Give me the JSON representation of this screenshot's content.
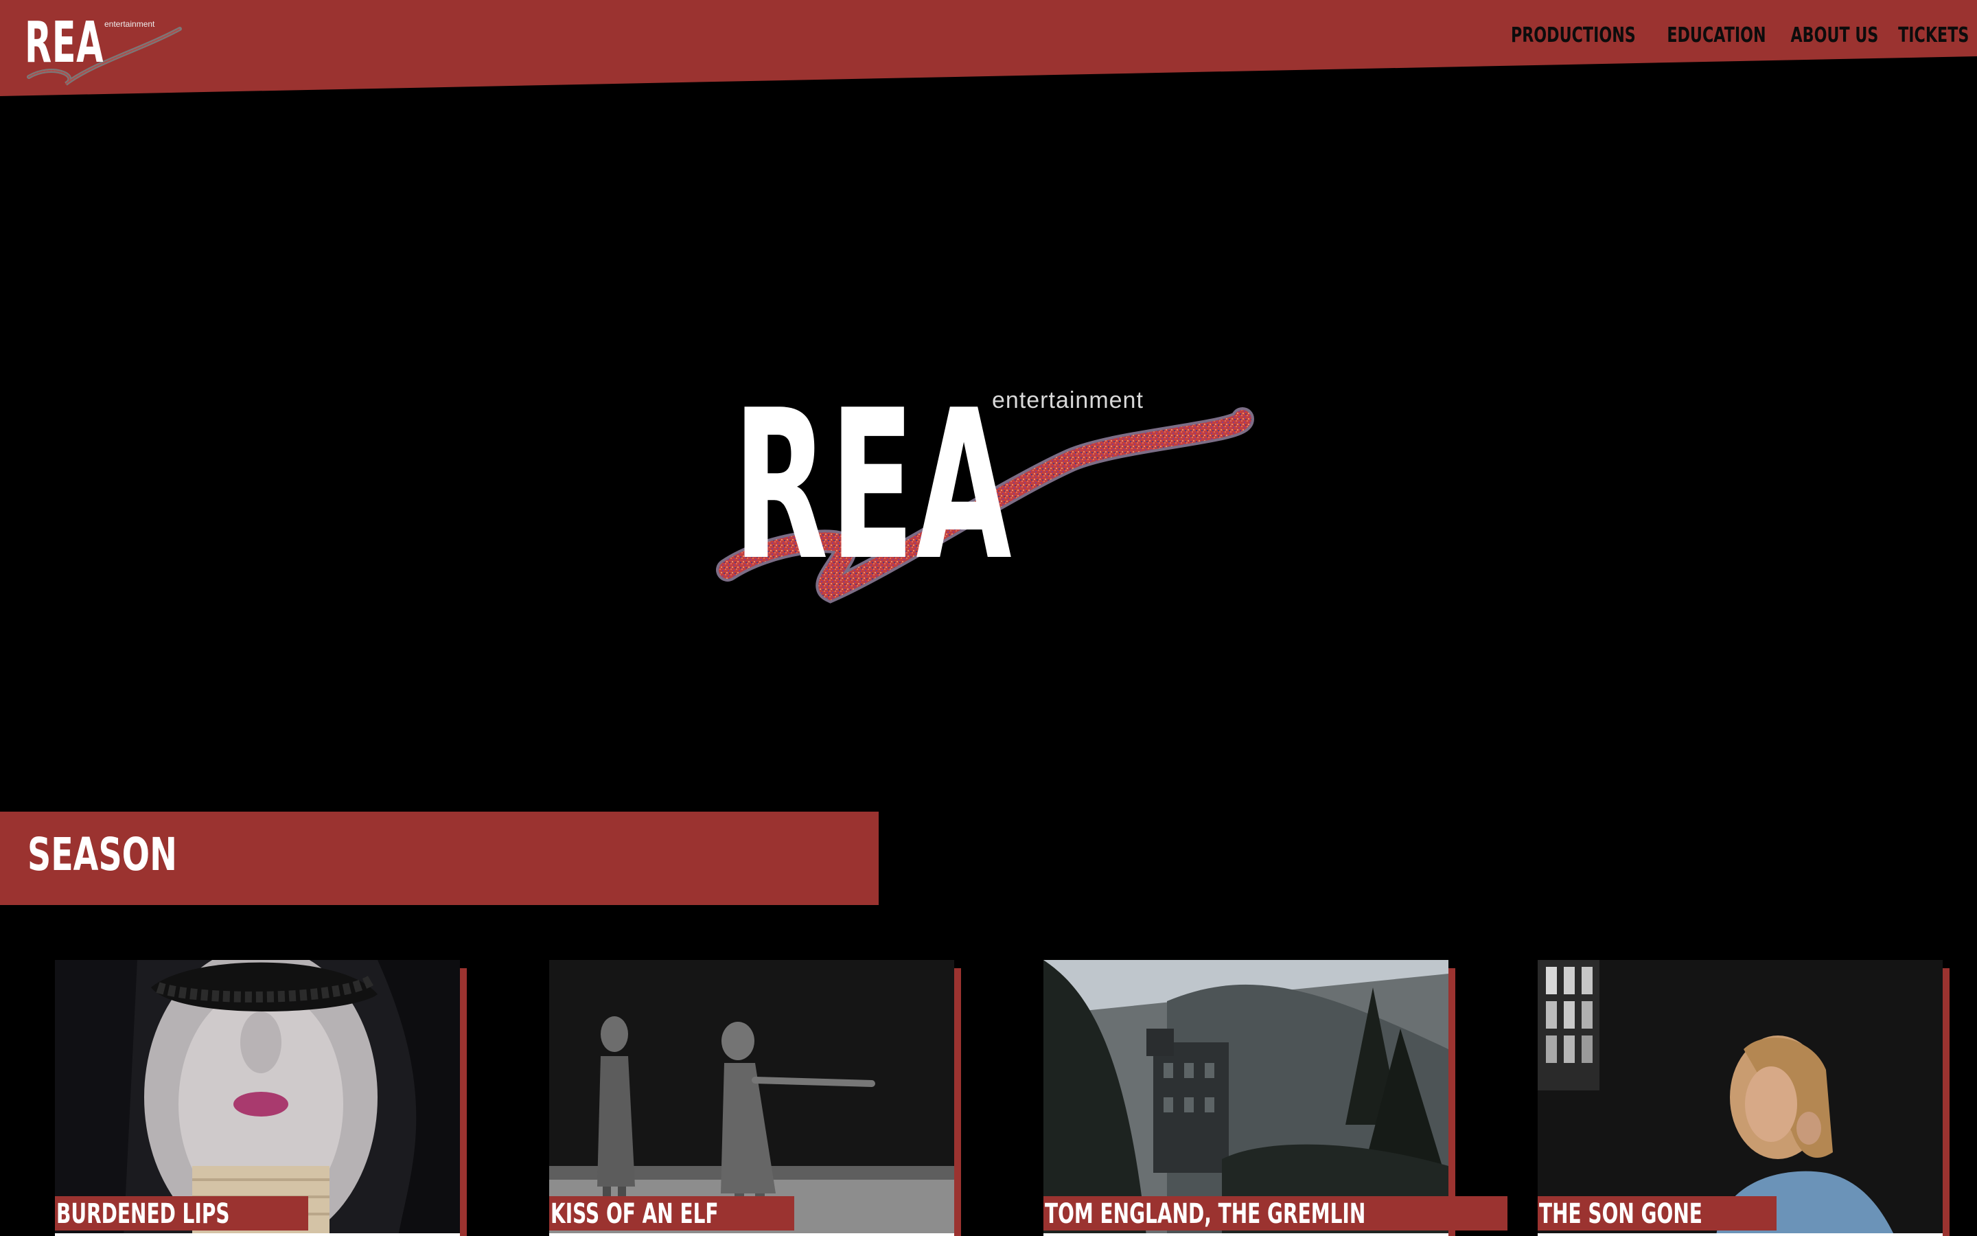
{
  "header": {
    "logo": {
      "wordmark": "REA",
      "tagline": "entertainment"
    },
    "nav": [
      {
        "label": "PRODUCTIONS"
      },
      {
        "label": "EDUCATION"
      },
      {
        "label": "ABOUT US"
      },
      {
        "label": "TICKETS"
      }
    ]
  },
  "hero": {
    "logo": {
      "wordmark": "REA",
      "tagline": "entertainment"
    }
  },
  "season": {
    "title": "SEASON",
    "productions": [
      {
        "title": "BURDENED LIPS",
        "image": "masked-woman-photo"
      },
      {
        "title": "KISS OF AN ELF",
        "image": "dancers-photo"
      },
      {
        "title": "TOM ENGLAND, THE GREMLIN",
        "image": "castle-forest-photo"
      },
      {
        "title": "THE SON GONE",
        "image": "woman-by-window-photo"
      }
    ]
  },
  "colors": {
    "brand_red": "#9b3330",
    "background": "#000000",
    "nav_text": "#0c0c0c",
    "text_light": "#ffffff"
  }
}
